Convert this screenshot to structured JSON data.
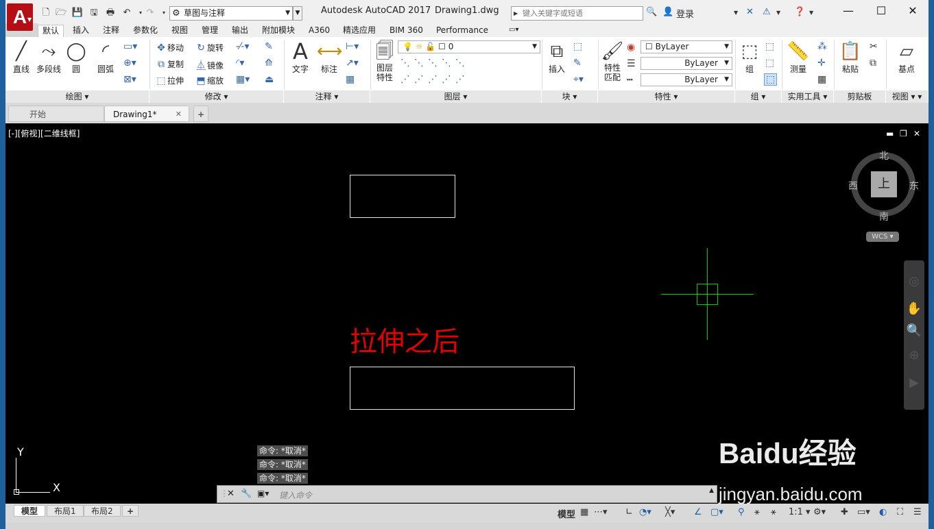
{
  "app": {
    "title": "Autodesk AutoCAD 2017",
    "document": "Drawing1.dwg",
    "logo_letter": "A",
    "workspace": "草图与注释",
    "search_placeholder": "键入关键字或短语",
    "login": "登录"
  },
  "ribbon_tabs": [
    "默认",
    "插入",
    "注释",
    "参数化",
    "视图",
    "管理",
    "输出",
    "附加模块",
    "A360",
    "精选应用",
    "BIM 360",
    "Performance"
  ],
  "panels": {
    "draw": {
      "title": "绘图",
      "line": "直线",
      "polyline": "多段线",
      "circle": "圆",
      "arc": "圆弧"
    },
    "modify": {
      "title": "修改",
      "move": "移动",
      "rotate": "旋转",
      "copy": "复制",
      "mirror": "镜像",
      "stretch": "拉伸",
      "scale": "缩放"
    },
    "annotation": {
      "title": "注释",
      "text": "文字",
      "dimension": "标注"
    },
    "layers": {
      "title": "图层",
      "layer_props_1": "图层",
      "layer_props_2": "特性",
      "current_layer": "0"
    },
    "block": {
      "title": "块",
      "insert": "插入"
    },
    "properties": {
      "title": "特性",
      "match_1": "特性",
      "match_2": "匹配",
      "color": "ByLayer",
      "linetype": "ByLayer",
      "lineweight": "ByLayer"
    },
    "groups": {
      "title": "组",
      "group": "组"
    },
    "utilities": {
      "title": "实用工具",
      "measure": "测量"
    },
    "clipboard": {
      "title": "剪贴板",
      "paste": "粘贴"
    },
    "view": {
      "title": "视图",
      "base": "基点"
    }
  },
  "doc_tabs": {
    "start": "开始",
    "drawing": "Drawing1*"
  },
  "viewport": {
    "label": "[-][俯视][二维线框]",
    "annotation_text": "拉伸之后",
    "viewcube": {
      "north": "北",
      "south": "南",
      "east": "东",
      "west": "西",
      "face": "上",
      "wcs": "WCS"
    },
    "ucs_x": "X",
    "ucs_y": "Y"
  },
  "command": {
    "history": [
      "命令: *取消*",
      "命令: *取消*",
      "命令: *取消*"
    ],
    "placeholder": "键入命令"
  },
  "layout_tabs": [
    "模型",
    "布局1",
    "布局2"
  ],
  "status": {
    "model": "模型",
    "scale": "1:1"
  },
  "watermark": {
    "brand": "Baidu经验",
    "url": "jingyan.baidu.com"
  },
  "colors": {
    "accent_red": "#e50000",
    "crosshair": "#00d000",
    "logo": "#b50e15"
  }
}
